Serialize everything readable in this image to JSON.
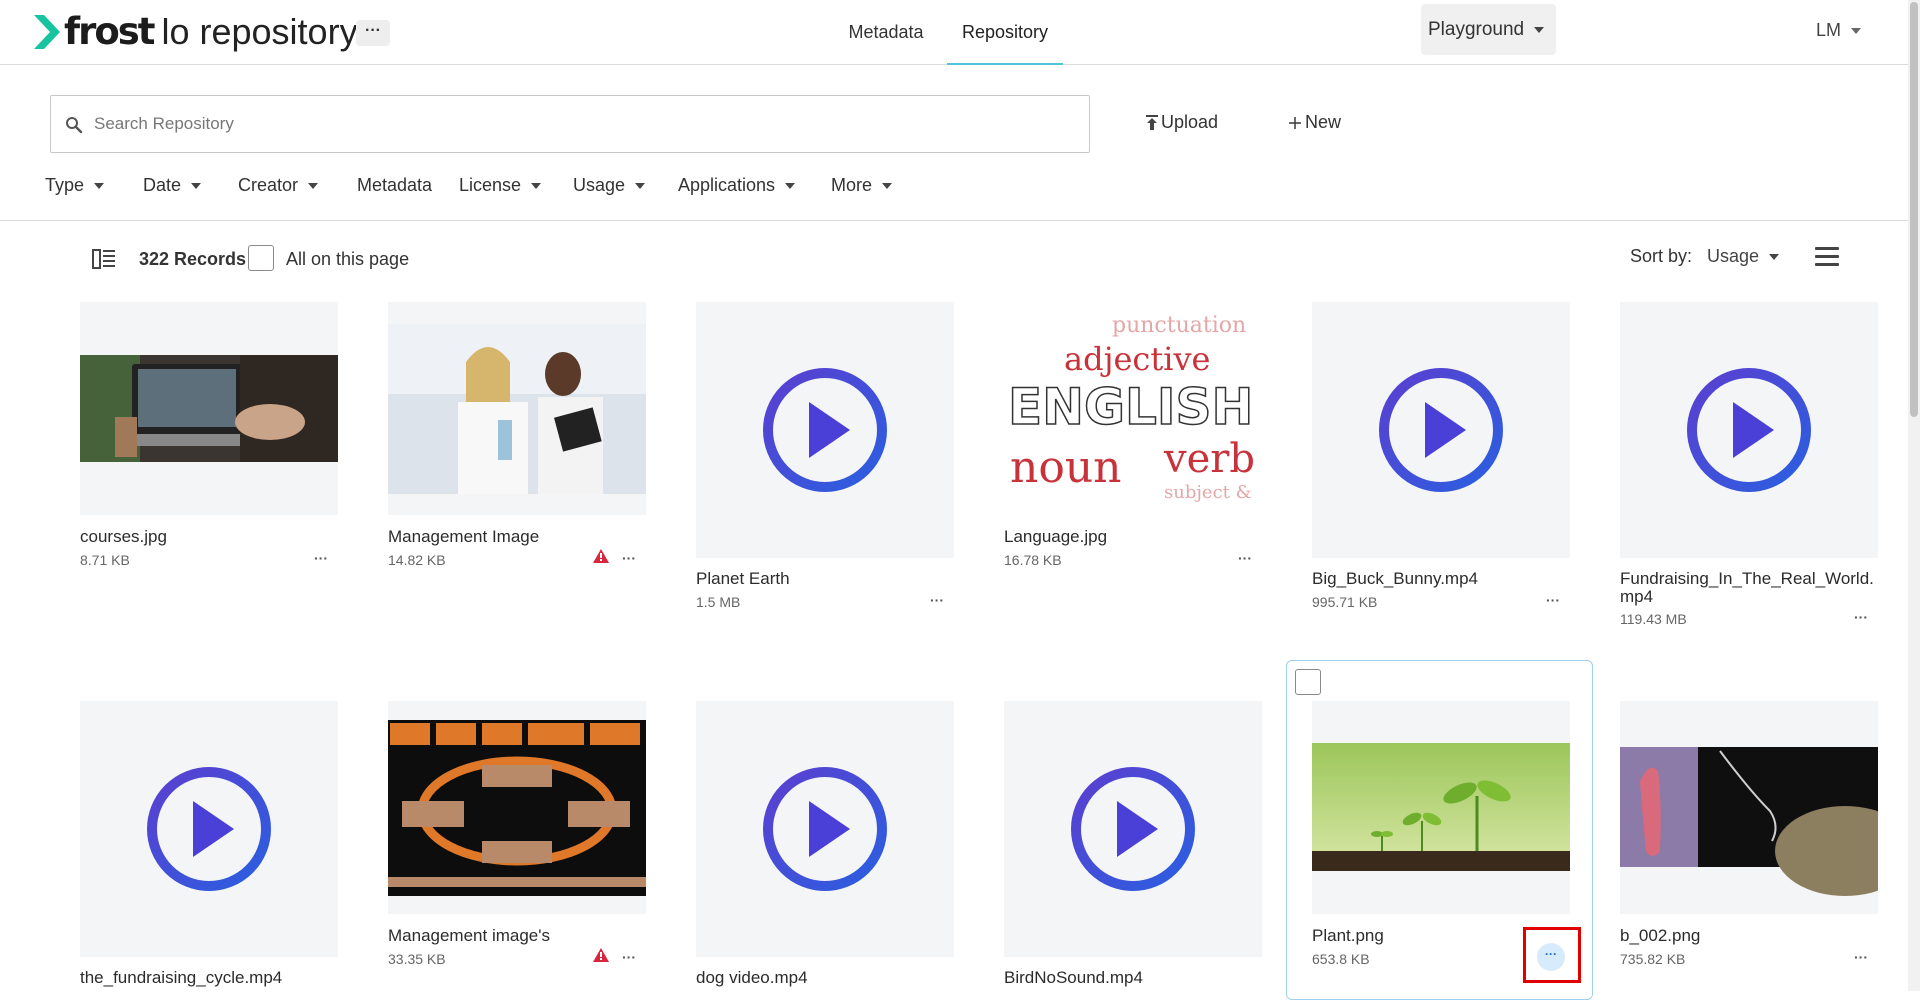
{
  "header": {
    "logo_word": "frost",
    "logo_rest": "lo repository",
    "tabs": [
      {
        "label": "Metadata",
        "active": false
      },
      {
        "label": "Repository",
        "active": true
      }
    ],
    "workspace": "Playground",
    "user_initials": "LM"
  },
  "search": {
    "placeholder": "Search Repository",
    "value": ""
  },
  "actions": {
    "upload": "Upload",
    "new": "New"
  },
  "filters": [
    "Type",
    "Date",
    "Creator",
    "Metadata",
    "License",
    "Usage",
    "Applications",
    "More"
  ],
  "toolbar": {
    "records": "322 Records",
    "all_on_page": "All on this page",
    "sort_label": "Sort by:",
    "sort_value": "Usage"
  },
  "items": [
    {
      "name": "courses.jpg",
      "size": "8.71 KB",
      "kind": "photo-laptop",
      "warning": false
    },
    {
      "name": "Management Image",
      "size": "14.82 KB",
      "kind": "photo-lab",
      "warning": true
    },
    {
      "name": "Planet Earth",
      "size": "1.5 MB",
      "kind": "video",
      "warning": false
    },
    {
      "name": "Language.jpg",
      "size": "16.78 KB",
      "kind": "photo-words",
      "warning": false
    },
    {
      "name": "Big_Buck_Bunny.mp4",
      "size": "995.71 KB",
      "kind": "video",
      "warning": false
    },
    {
      "name": "Fundraising_In_The_Real_World.mp4",
      "size": "119.43 MB",
      "kind": "video",
      "warning": false
    },
    {
      "name": "the_fundraising_cycle.mp4",
      "size": "",
      "kind": "video",
      "warning": false
    },
    {
      "name": "Management image's",
      "size": "33.35 KB",
      "kind": "photo-diagram",
      "warning": true
    },
    {
      "name": "dog video.mp4",
      "size": "",
      "kind": "video",
      "warning": false
    },
    {
      "name": "BirdNoSound.mp4",
      "size": "",
      "kind": "video",
      "warning": false
    },
    {
      "name": "Plant.png",
      "size": "653.8 KB",
      "kind": "photo-plant",
      "warning": false
    },
    {
      "name": "b_002.png",
      "size": "735.82 KB",
      "kind": "photo-cell",
      "warning": false
    }
  ],
  "thumbnail_words": {
    "line1": "punctuation",
    "line2": "adjective",
    "line3": "ENGLISH",
    "line4": "noun",
    "line5": "verb",
    "line6": "subject &"
  },
  "colors": {
    "accent": "#4fc3d9",
    "play": "#4a3fd6",
    "warning": "#d7263d",
    "highlight_border": "#e00000"
  }
}
